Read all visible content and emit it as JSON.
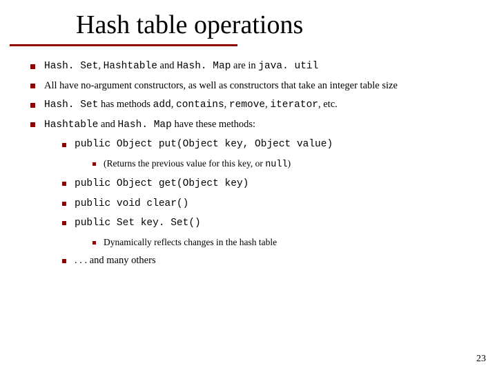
{
  "slide": {
    "title": "Hash table operations",
    "page_number": "23",
    "bullets": [
      {
        "runs": [
          {
            "t": "Hash. Set",
            "m": true
          },
          {
            "t": ", "
          },
          {
            "t": "Hashtable",
            "m": true
          },
          {
            "t": " and "
          },
          {
            "t": "Hash. Map",
            "m": true
          },
          {
            "t": " are in "
          },
          {
            "t": "java. util",
            "m": true
          }
        ]
      },
      {
        "runs": [
          {
            "t": "All  have no-argument constructors, as well as constructors that take an integer table size"
          }
        ]
      },
      {
        "runs": [
          {
            "t": "Hash. Set",
            "m": true
          },
          {
            "t": " has methods "
          },
          {
            "t": "add",
            "m": true
          },
          {
            "t": ", "
          },
          {
            "t": "contains",
            "m": true
          },
          {
            "t": ", "
          },
          {
            "t": "remove",
            "m": true
          },
          {
            "t": ", "
          },
          {
            "t": "iterator",
            "m": true
          },
          {
            "t": ", etc."
          }
        ]
      },
      {
        "runs": [
          {
            "t": "Hashtable",
            "m": true
          },
          {
            "t": " and "
          },
          {
            "t": "Hash. Map",
            "m": true
          },
          {
            "t": "  have these methods:"
          }
        ],
        "children": [
          {
            "runs": [
              {
                "t": "public Object put(Object key, Object value)",
                "m": true
              }
            ],
            "children": [
              {
                "runs": [
                  {
                    "t": "(Returns the previous value for this key, or "
                  },
                  {
                    "t": "null",
                    "m": true
                  },
                  {
                    "t": ")"
                  }
                ]
              }
            ]
          },
          {
            "runs": [
              {
                "t": "public Object get(Object key)",
                "m": true
              }
            ]
          },
          {
            "runs": [
              {
                "t": "public void clear()",
                "m": true
              }
            ]
          },
          {
            "runs": [
              {
                "t": "public Set key. Set()",
                "m": true
              }
            ],
            "children": [
              {
                "runs": [
                  {
                    "t": "Dynamically reflects changes in the hash table"
                  }
                ]
              }
            ]
          },
          {
            "runs": [
              {
                "t": ". . . and many others"
              }
            ]
          }
        ]
      }
    ]
  }
}
